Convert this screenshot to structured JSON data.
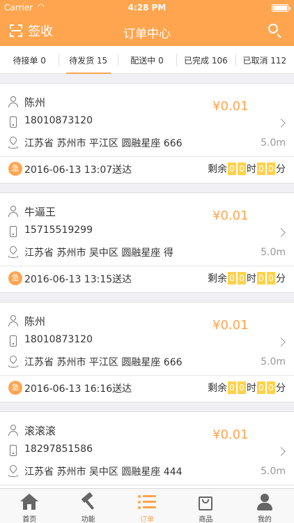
{
  "status_bar": {
    "carrier": "Carrier",
    "time": "4:28 PM"
  },
  "header": {
    "scan_label": "签收",
    "title": "订单中心"
  },
  "colors": {
    "accent": "#ffa54f",
    "countdown_box": "#ffd24a",
    "background": "#efeff4"
  },
  "tabs": [
    {
      "label": "待接单 0",
      "active": false
    },
    {
      "label": "待发货 15",
      "active": true
    },
    {
      "label": "配送中 0",
      "active": false
    },
    {
      "label": "已完成 106",
      "active": false
    },
    {
      "label": "已取消 112",
      "active": false
    }
  ],
  "orders": [
    {
      "name": "陈州",
      "phone": "18010873120",
      "address": "江苏省 苏州市 平江区 圆融星座 666",
      "price": "¥0.01",
      "distance": "5.0m",
      "urgent": "急",
      "deliver_time": "2016-06-13 13:07送达",
      "remain_label": "剩余",
      "hour_digits": [
        "0",
        "0"
      ],
      "hour_label": "时",
      "minute_digits": [
        "0",
        "0"
      ],
      "minute_label": "分"
    },
    {
      "name": "牛逼王",
      "phone": "15715519299",
      "address": "江苏省 苏州市 吴中区 圆融星座 得",
      "price": "¥0.01",
      "distance": "5.0m",
      "urgent": "急",
      "deliver_time": "2016-06-13 13:15送达",
      "remain_label": "剩余",
      "hour_digits": [
        "0",
        "0"
      ],
      "hour_label": "时",
      "minute_digits": [
        "0",
        "0"
      ],
      "minute_label": "分"
    },
    {
      "name": "陈州",
      "phone": "18010873120",
      "address": "江苏省 苏州市 平江区 圆融星座 666",
      "price": "¥0.01",
      "distance": "5.0m",
      "urgent": "急",
      "deliver_time": "2016-06-13 16:16送达",
      "remain_label": "剩余",
      "hour_digits": [
        "0",
        "0"
      ],
      "hour_label": "时",
      "minute_digits": [
        "0",
        "0"
      ],
      "minute_label": "分"
    },
    {
      "name": "滚滚滚",
      "phone": "18297851586",
      "address": "江苏省 苏州市 吴中区 圆融星座 444",
      "price": "¥0.01",
      "distance": "5.0m",
      "urgent": "急",
      "deliver_time": "",
      "remain_label": "",
      "hour_digits": [
        "",
        ""
      ],
      "hour_label": "",
      "minute_digits": [
        "",
        ""
      ],
      "minute_label": ""
    }
  ],
  "tab_bar": [
    {
      "label": "首页",
      "icon": "home-icon",
      "active": false
    },
    {
      "label": "功能",
      "icon": "hammer-icon",
      "active": false
    },
    {
      "label": "订单",
      "icon": "list-icon",
      "active": true
    },
    {
      "label": "商品",
      "icon": "bag-icon",
      "active": false
    },
    {
      "label": "我的",
      "icon": "user-icon",
      "active": false
    }
  ]
}
